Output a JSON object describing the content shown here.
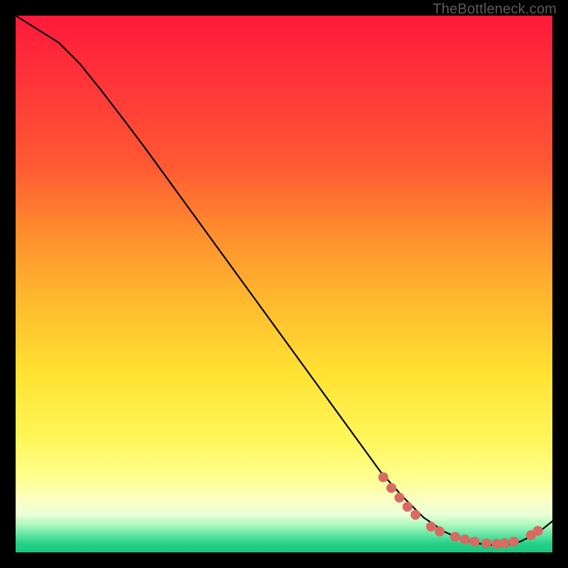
{
  "watermark": "TheBottleneck.com",
  "chart_data": {
    "type": "line",
    "title": "",
    "xlabel": "",
    "ylabel": "",
    "xlim": [
      0,
      100
    ],
    "ylim": [
      0,
      100
    ],
    "grid": false,
    "legend": false,
    "series": [
      {
        "name": "bottleneck-curve",
        "x": [
          0,
          4,
          8,
          12,
          16,
          20,
          24,
          28,
          32,
          36,
          40,
          44,
          48,
          52,
          56,
          60,
          64,
          68,
          72,
          76,
          80,
          82,
          84,
          86,
          88,
          90,
          92,
          94,
          96,
          98,
          100
        ],
        "y": [
          100,
          97.5,
          95,
          91.0,
          86.0,
          80.8,
          75.5,
          70.0,
          64.5,
          59.0,
          53.5,
          48.0,
          42.5,
          37.0,
          31.5,
          26.0,
          20.5,
          15.0,
          10.5,
          6.5,
          3.8,
          2.9,
          2.2,
          1.7,
          1.4,
          1.3,
          1.5,
          2.0,
          3.0,
          4.2,
          5.8
        ],
        "color": "#000000"
      }
    ],
    "markers": {
      "name": "highlight-dots",
      "color": "#d96a63",
      "radius_px": 7,
      "points": [
        {
          "x": 68.5,
          "y": 14.0
        },
        {
          "x": 70.0,
          "y": 12.0
        },
        {
          "x": 71.5,
          "y": 10.2
        },
        {
          "x": 73.0,
          "y": 8.5
        },
        {
          "x": 74.5,
          "y": 7.0
        },
        {
          "x": 77.4,
          "y": 4.8
        },
        {
          "x": 79.0,
          "y": 3.9
        },
        {
          "x": 81.9,
          "y": 2.9
        },
        {
          "x": 83.7,
          "y": 2.4
        },
        {
          "x": 85.5,
          "y": 2.0
        },
        {
          "x": 87.7,
          "y": 1.7
        },
        {
          "x": 89.6,
          "y": 1.6
        },
        {
          "x": 91.1,
          "y": 1.7
        },
        {
          "x": 92.8,
          "y": 2.0
        },
        {
          "x": 96.0,
          "y": 3.2
        },
        {
          "x": 97.3,
          "y": 4.0
        }
      ]
    },
    "background_gradient": {
      "direction": "vertical",
      "stops": [
        {
          "pos": 0.0,
          "color": "#ff1a3a"
        },
        {
          "pos": 0.4,
          "color": "#ff8b2e"
        },
        {
          "pos": 0.67,
          "color": "#ffe333"
        },
        {
          "pos": 0.9,
          "color": "#fcffc0"
        },
        {
          "pos": 0.97,
          "color": "#57e29e"
        },
        {
          "pos": 1.0,
          "color": "#18c87e"
        }
      ]
    }
  }
}
